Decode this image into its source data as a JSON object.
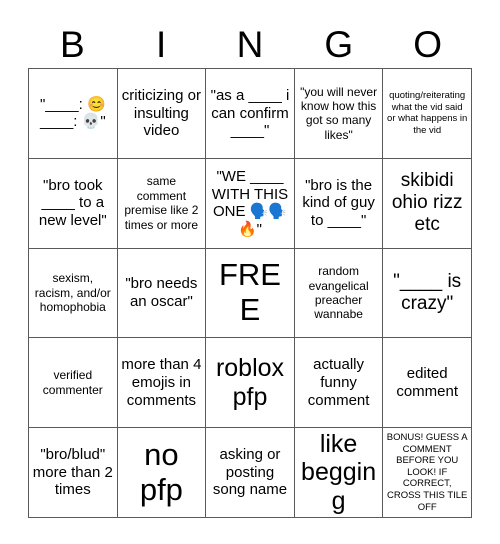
{
  "header": {
    "letters": [
      "B",
      "I",
      "N",
      "G",
      "O"
    ]
  },
  "colors": {
    "background": "#ffffff",
    "grid_line": "#5a5a5a",
    "text": "#000000"
  },
  "grid": {
    "rows": 5,
    "columns": 5,
    "free_space_index": 12
  },
  "cells": [
    {
      "text": "\"____: 😊\n____: 💀\"",
      "size": "md"
    },
    {
      "text": "criticizing or insulting video",
      "size": "md"
    },
    {
      "text": "\"as a ____ i can confirm ____\"",
      "size": "md"
    },
    {
      "text": "\"you will never know how this got so many likes\"",
      "size": "sm"
    },
    {
      "text": "quoting/reiterating what the vid said or what happens in the vid",
      "size": "xs"
    },
    {
      "text": "\"bro took ____ to a new level\"",
      "size": "md"
    },
    {
      "text": "same comment premise like 2 times or more",
      "size": "sm"
    },
    {
      "text": "\"WE ____ WITH THIS ONE 🗣️🗣️🔥\"",
      "size": "md"
    },
    {
      "text": "\"bro is the kind of guy to ____\"",
      "size": "md"
    },
    {
      "text": "skibidi ohio rizz etc",
      "size": "lg"
    },
    {
      "text": "sexism, racism, and/or homophobia",
      "size": "sm"
    },
    {
      "text": "\"bro needs an oscar\"",
      "size": "md"
    },
    {
      "text": "FREE",
      "size": "xxl"
    },
    {
      "text": "random evangelical preacher wannabe",
      "size": "sm"
    },
    {
      "text": "\"____ is crazy\"",
      "size": "lg"
    },
    {
      "text": "verified commenter",
      "size": "sm"
    },
    {
      "text": "more than 4 emojis in comments",
      "size": "md"
    },
    {
      "text": "roblox pfp",
      "size": "xl"
    },
    {
      "text": "actually funny comment",
      "size": "md"
    },
    {
      "text": "edited comment",
      "size": "md"
    },
    {
      "text": "\"bro/blud\" more than 2 times",
      "size": "md"
    },
    {
      "text": "no pfp",
      "size": "xxl"
    },
    {
      "text": "asking or posting song name",
      "size": "md"
    },
    {
      "text": "like begging",
      "size": "xl"
    },
    {
      "text": "BONUS! GUESS A COMMENT BEFORE YOU LOOK! IF CORRECT, CROSS THIS TILE OFF",
      "size": "xs"
    }
  ]
}
